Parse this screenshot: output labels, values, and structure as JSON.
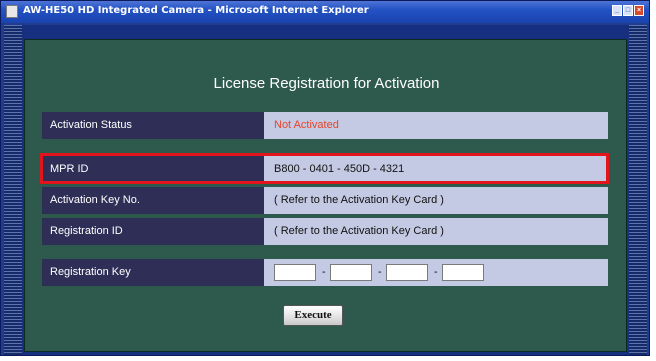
{
  "window": {
    "title": "AW-HE50 HD Integrated Camera - Microsoft Internet Explorer",
    "controls": {
      "minimize": "_",
      "maximize": "□",
      "close": "×"
    }
  },
  "panel": {
    "title": "License Registration for Activation",
    "activation_status": {
      "label": "Activation Status",
      "value": "Not Activated",
      "value_color": "#e8432b"
    },
    "mpr_id": {
      "label": "MPR ID",
      "value": "B800 - 0401 - 450D - 4321"
    },
    "activation_key": {
      "label": "Activation Key No.",
      "value": "( Refer to the Activation Key Card )"
    },
    "registration_id": {
      "label": "Registration ID",
      "value": "( Refer to the Activation Key Card )"
    },
    "registration_key": {
      "label": "Registration Key",
      "separator": "-",
      "fields": [
        "",
        "",
        "",
        ""
      ]
    },
    "execute_label": "Execute"
  },
  "colors": {
    "background": "#2e5a4d",
    "label_bg": "#2e2e57",
    "value_bg": "#c4cae3",
    "highlight": "#e2141c",
    "titlebar": "#2352c4"
  }
}
